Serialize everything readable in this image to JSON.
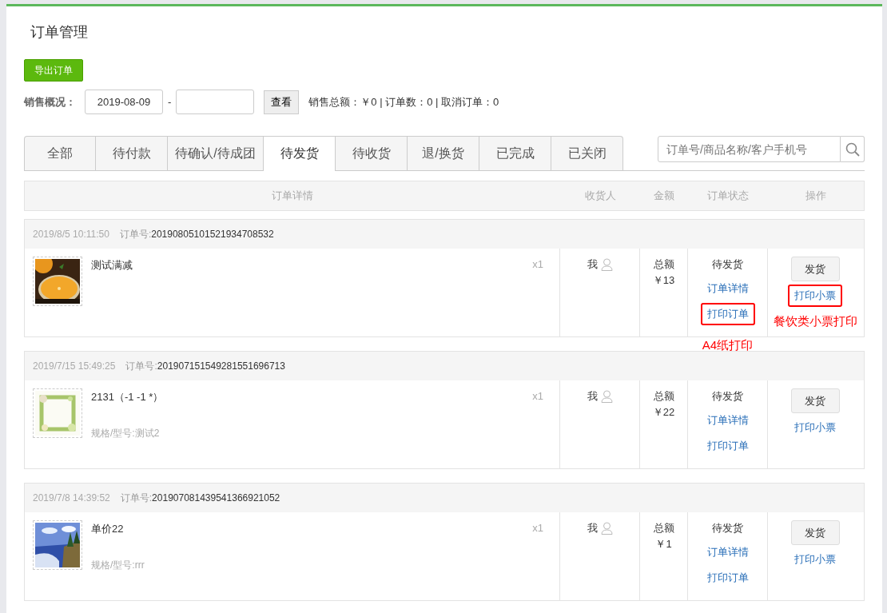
{
  "page_title": "订单管理",
  "export_button": "导出订单",
  "sales_overview": {
    "label": "销售概况：",
    "start_date": "2019-08-09",
    "separator": "-",
    "view_button": "查看",
    "summary": "销售总额：￥0 | 订单数：0 | 取消订单：0"
  },
  "tabs": [
    {
      "label": "全部",
      "selected": false
    },
    {
      "label": "待付款",
      "selected": false
    },
    {
      "label": "待确认/待成团",
      "selected": false
    },
    {
      "label": "待发货",
      "selected": true
    },
    {
      "label": "待收货",
      "selected": false
    },
    {
      "label": "退/换货",
      "selected": false
    },
    {
      "label": "已完成",
      "selected": false
    },
    {
      "label": "已关闭",
      "selected": false
    }
  ],
  "search": {
    "placeholder": "订单号/商品名称/客户手机号"
  },
  "table": {
    "columns": [
      "订单详情",
      "收货人",
      "金额",
      "订单状态",
      "操作"
    ],
    "orders": [
      {
        "time": "2019/8/5 10:11:50",
        "order_no_label": "订单号:",
        "order_no": "20190805101521934708532",
        "product": "测试满减",
        "quantity": "x1",
        "receiver": "我",
        "amount_label": "总额",
        "amount": "￥13",
        "status": "待发货",
        "detail_link": "订单详情",
        "print_order": {
          "label": "打印订单",
          "highlighted": true,
          "note": "A4纸打印"
        },
        "ship_button": "发货",
        "print_ticket": {
          "label": "打印小票",
          "highlighted": true,
          "note": "餐饮类小票打印"
        }
      },
      {
        "time": "2019/7/15 15:49:25",
        "order_no_label": "订单号:",
        "order_no": "201907151549281551696713",
        "product": "2131（-1 -1 *）",
        "spec": "规格/型号:测试2",
        "quantity": "x1",
        "receiver": "我",
        "amount_label": "总额",
        "amount": "￥22",
        "status": "待发货",
        "detail_link": "订单详情",
        "print_order": {
          "label": "打印订单",
          "highlighted": false
        },
        "ship_button": "发货",
        "print_ticket": {
          "label": "打印小票",
          "highlighted": false
        }
      },
      {
        "time": "2019/7/8 14:39:52",
        "order_no_label": "订单号:",
        "order_no": "201907081439541366921052",
        "product": "单价22",
        "spec": "规格/型号:rrr",
        "quantity": "x1",
        "receiver": "我",
        "amount_label": "总额",
        "amount": "￥1",
        "status": "待发货",
        "detail_link": "订单详情",
        "print_order": {
          "label": "打印订单",
          "highlighted": false
        },
        "ship_button": "发货",
        "print_ticket": {
          "label": "打印小票",
          "highlighted": false
        }
      }
    ]
  }
}
